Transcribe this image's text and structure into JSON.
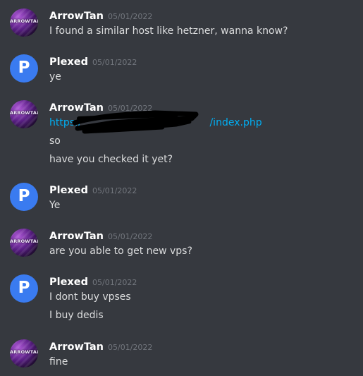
{
  "users": {
    "arrowtan": {
      "name": "ArrowTan",
      "avatar_text": "ARROWTAN"
    },
    "plexed": {
      "name": "Plexed",
      "avatar_letter": "P"
    }
  },
  "messages": [
    {
      "author": "ArrowTan",
      "timestamp": "05/01/2022",
      "lines": [
        "I found a similar host like hetzner, wanna know?"
      ]
    },
    {
      "author": "Plexed",
      "timestamp": "05/01/2022",
      "lines": [
        "ye"
      ]
    },
    {
      "author": "ArrowTan",
      "timestamp": "05/01/2022",
      "link": {
        "start": "https:/",
        "end": "/index.php"
      },
      "lines": [
        "so",
        "have you checked it yet?"
      ]
    },
    {
      "author": "Plexed",
      "timestamp": "05/01/2022",
      "lines": [
        "Ye"
      ]
    },
    {
      "author": "ArrowTan",
      "timestamp": "05/01/2022",
      "lines": [
        "are you able to get new vps?"
      ]
    },
    {
      "author": "Plexed",
      "timestamp": "05/01/2022",
      "lines": [
        "I dont buy vpses",
        "I buy dedis"
      ]
    },
    {
      "author": "ArrowTan",
      "timestamp": "05/01/2022",
      "lines": [
        "fine"
      ]
    }
  ],
  "colors": {
    "background": "#36393f",
    "text": "#dcddde",
    "username": "#ffffff",
    "timestamp": "#72767d",
    "link": "#00aff4",
    "plexed_avatar": "#3a7bf0"
  }
}
